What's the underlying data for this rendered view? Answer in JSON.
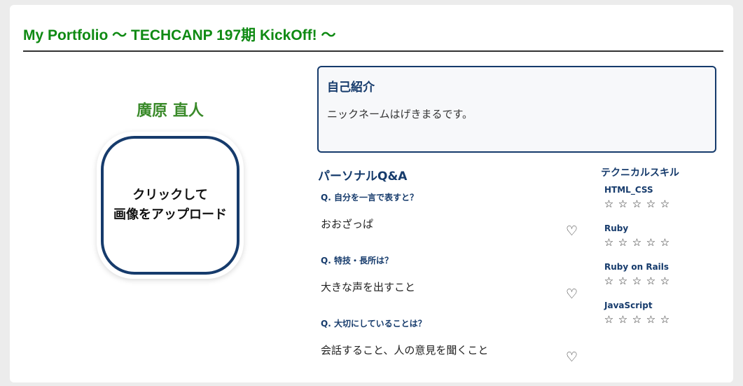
{
  "header": {
    "title": "My Portfolio 〜 TECHCANP 197期 KickOff! 〜"
  },
  "profile": {
    "name": "廣原 直人",
    "upload_line1": "クリックして",
    "upload_line2": "画像をアップロード"
  },
  "intro": {
    "title": "自己紹介",
    "text": "ニックネームはげきまるです。"
  },
  "qa": {
    "title": "パーソナルQ&A",
    "heart_icon": "heart-outline-icon",
    "items": [
      {
        "question": "Q. 自分を一言で表すと？",
        "answer": "おおざっぱ",
        "heart": "♡"
      },
      {
        "question": "Q. 特技・長所は？",
        "answer": "大きな声を出すこと",
        "heart": "♡"
      },
      {
        "question": "Q. 大切にしていることは？",
        "answer": "会話すること、人の意見を聞くこと",
        "heart": "♡"
      }
    ]
  },
  "skills": {
    "title": "テクニカルスキル",
    "star_icon": "star-outline-icon",
    "items": [
      {
        "name": "HTML_CSS",
        "rating": 0,
        "max": 5,
        "stars": [
          "☆",
          "☆",
          "☆",
          "☆",
          "☆"
        ]
      },
      {
        "name": "Ruby",
        "rating": 0,
        "max": 5,
        "stars": [
          "☆",
          "☆",
          "☆",
          "☆",
          "☆"
        ]
      },
      {
        "name": "Ruby on Rails",
        "rating": 0,
        "max": 5,
        "stars": [
          "☆",
          "☆",
          "☆",
          "☆",
          "☆"
        ]
      },
      {
        "name": "JavaScript",
        "rating": 0,
        "max": 5,
        "stars": [
          "☆",
          "☆",
          "☆",
          "☆",
          "☆"
        ]
      }
    ]
  },
  "colors": {
    "title_green": "#0f8a13",
    "name_green": "#3a8a2a",
    "navy": "#163b6c"
  }
}
